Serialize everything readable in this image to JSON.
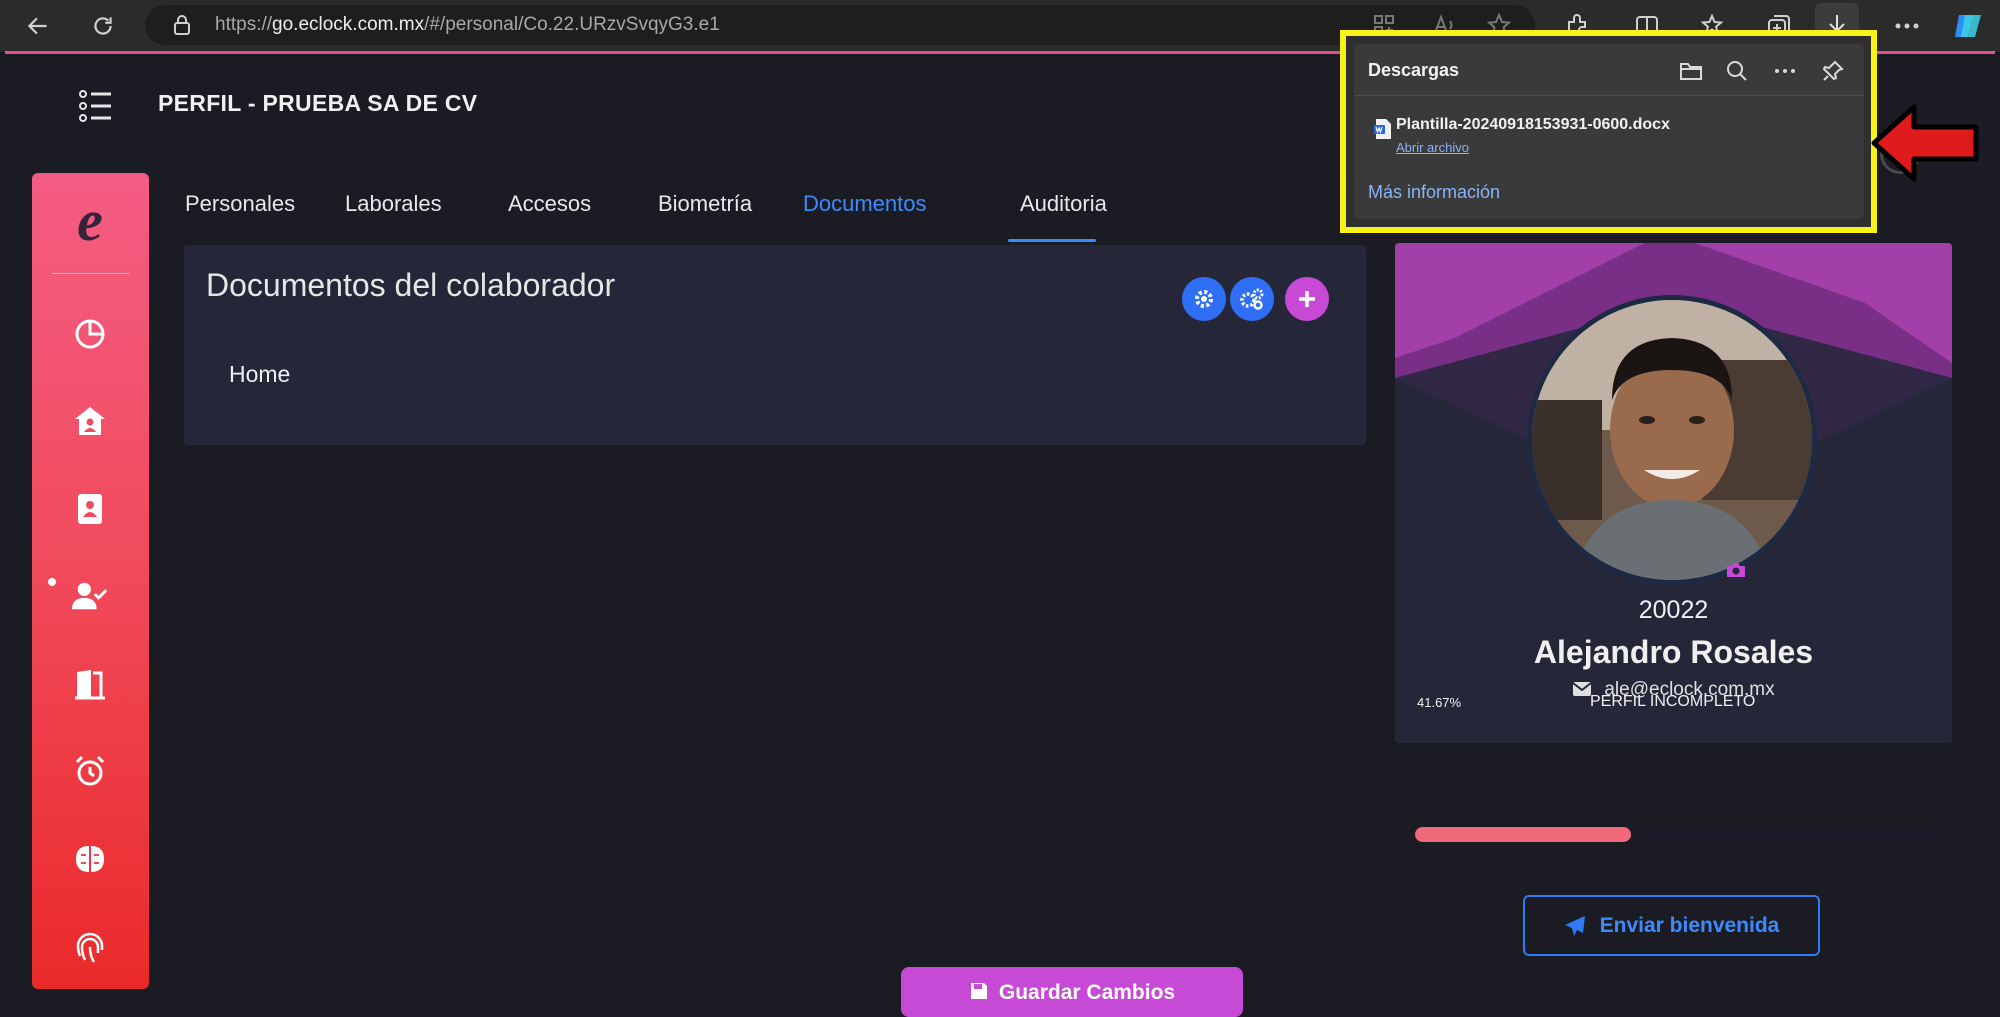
{
  "browser": {
    "url_prefix": "https://",
    "url_domain": "go.eclock.com.mx",
    "url_path": "/#/personal/Co.22.URzvSvqyG3.e1"
  },
  "app": {
    "page_title": "PERFIL - PRUEBA SA DE CV",
    "sidebar_logo": "e"
  },
  "tabs": [
    {
      "label": "Personales"
    },
    {
      "label": "Laborales"
    },
    {
      "label": "Accesos"
    },
    {
      "label": "Biometría"
    },
    {
      "label": "Documentos"
    },
    {
      "label": "Auditoria"
    }
  ],
  "active_tab": "Documentos",
  "documents": {
    "title": "Documentos del colaborador",
    "folder": "Home"
  },
  "profile": {
    "employee_id": "20022",
    "name": "Alejandro Rosales",
    "email": "ale@eclock.com.mx",
    "progress_text": "41.67%",
    "progress_value": 0.4167,
    "status": "PERFIL INCOMPLETO",
    "welcome_button": "Enviar bienvenida"
  },
  "save_button": "Guardar Cambios",
  "downloads": {
    "header": "Descargas",
    "file_name": "Plantilla-20240918153931-0600.docx",
    "open_link": "Abrir archivo",
    "more_info": "Más información"
  },
  "colors": {
    "accent_blue": "#3b8bff",
    "sidebar_top": "#f45c84",
    "sidebar_bottom": "#ea2a2a",
    "highlight": "#f7f21a",
    "arrow": "#e01b1b",
    "save_purple": "#c64ad5"
  }
}
